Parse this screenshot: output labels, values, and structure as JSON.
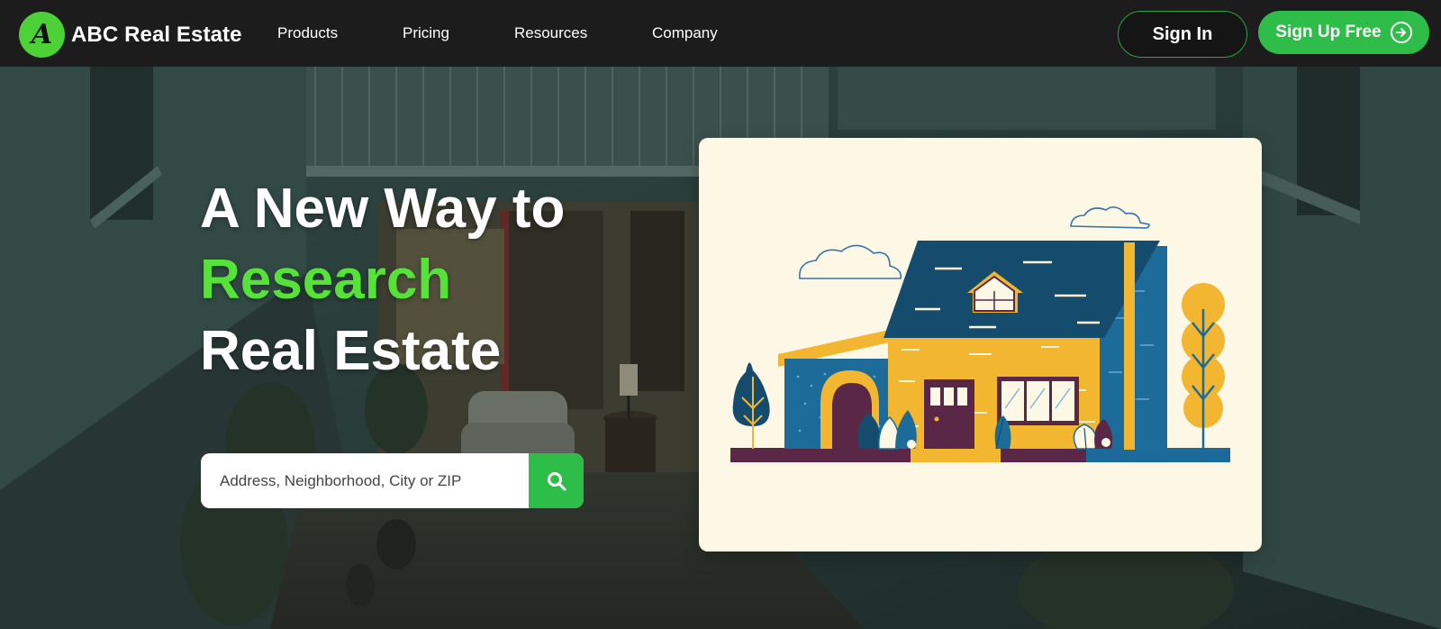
{
  "brand": {
    "name": "ABC Real Estate",
    "logo_letter": "A"
  },
  "nav": {
    "links": [
      {
        "label": "Products"
      },
      {
        "label": "Pricing"
      },
      {
        "label": "Resources"
      },
      {
        "label": "Company"
      }
    ],
    "sign_in": "Sign In",
    "sign_up": "Sign Up Free"
  },
  "hero": {
    "title_line1": "A New Way to",
    "title_accent": "Research",
    "title_line3": "Real Estate",
    "search_placeholder": "Address, Neighborhood, City or ZIP"
  },
  "colors": {
    "accent": "#2fbd4a",
    "accent_text": "#57e23a",
    "nav_bg": "#1c1c1c",
    "card_bg": "#fdf8e6"
  },
  "icons": [
    "logo-letter-icon",
    "arrow-right-circle-icon",
    "search-icon",
    "house-illustration"
  ]
}
